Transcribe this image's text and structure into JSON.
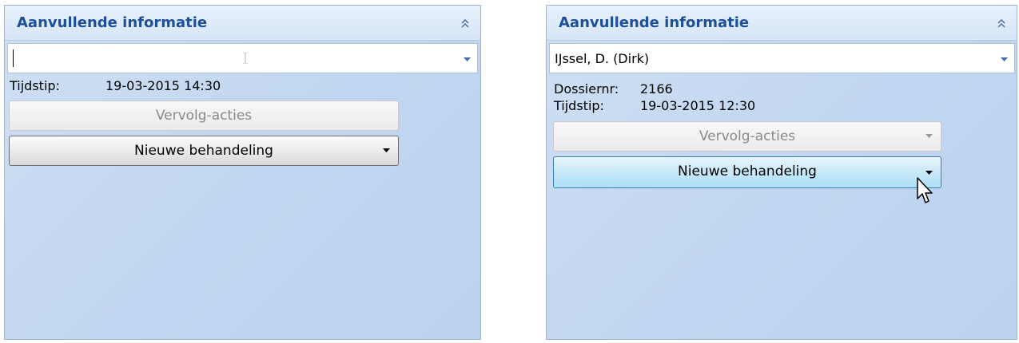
{
  "left_panel": {
    "header_title": "Aanvullende informatie",
    "combo_value": "",
    "tijdstip_label": "Tijdstip:",
    "tijdstip_value": "19-03-2015 14:30",
    "vervolg_button": "Vervolg-acties",
    "nieuwe_button": "Nieuwe behandeling"
  },
  "right_panel": {
    "header_title": "Aanvullende informatie",
    "combo_value": "IJssel, D. (Dirk)",
    "dossier_label": "Dossiernr:",
    "dossier_value": "2166",
    "tijdstip_label": "Tijdstip:",
    "tijdstip_value": "19-03-2015 12:30",
    "vervolg_button": "Vervolg-acties",
    "nieuwe_button": "Nieuwe behandeling"
  },
  "icons": {
    "collapse": "double-chevron-up-icon",
    "dropdown": "dropdown-arrow-icon",
    "cursor": "mouse-pointer-icon"
  },
  "colors": {
    "header_text": "#1e4f99",
    "panel_bg": "#c2d7f0",
    "hover_button": "#ade0f7"
  }
}
